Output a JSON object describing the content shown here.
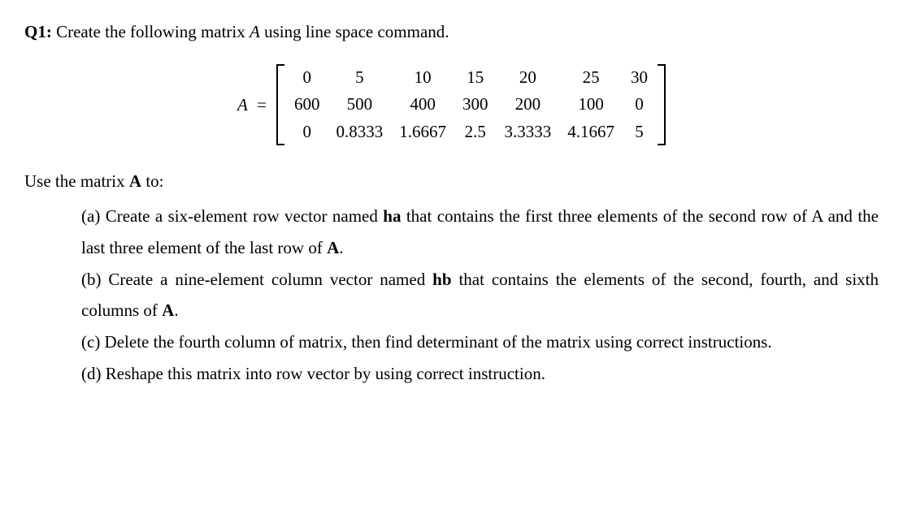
{
  "q_label": "Q1:",
  "q_text_before_A": " Create the following matrix ",
  "q_A": "A",
  "q_text_after_A": " using line space command.",
  "matrix_label_A": "A",
  "matrix_equals": " = ",
  "matrix": {
    "rows": [
      [
        "0",
        "5",
        "10",
        "15",
        "20",
        "25",
        "30"
      ],
      [
        "600",
        "500",
        "400",
        "300",
        "200",
        "100",
        "0"
      ],
      [
        "0",
        "0.8333",
        "1.6667",
        "2.5",
        "3.3333",
        "4.1667",
        "5"
      ]
    ]
  },
  "subprompt_before": "Use the matrix ",
  "subprompt_A": "A",
  "subprompt_after": " to:",
  "parts": {
    "a": {
      "pre": "(a) Create a six-element row vector named ",
      "ha": "ha",
      "post": " that contains the first three elements of the second row of A and the last three element of the last row of ",
      "A": "A",
      "end": "."
    },
    "b": {
      "pre": "(b) Create a nine-element column vector named ",
      "hb": "hb",
      "post": " that contains the elements of the second, fourth, and sixth columns of ",
      "A": "A",
      "end": "."
    },
    "c": {
      "text": "(c) Delete the fourth column of matrix, then find determinant of the matrix using correct instructions."
    },
    "d": {
      "text": "(d) Reshape this matrix into row vector by using correct instruction."
    }
  }
}
